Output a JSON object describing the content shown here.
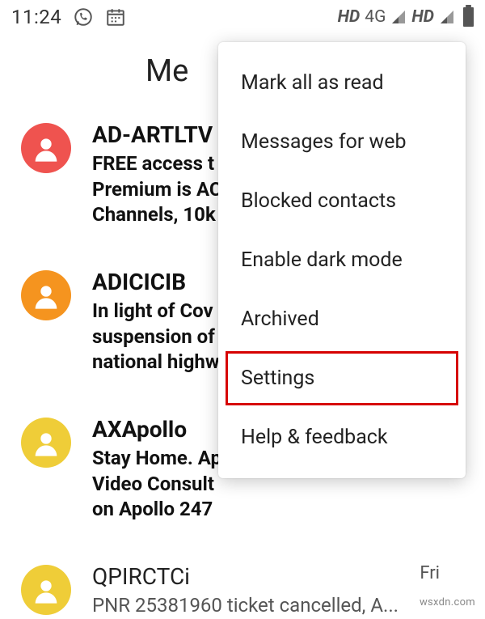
{
  "status": {
    "time": "11:24",
    "net1": "HD",
    "net1b": "4G",
    "net2": "HD"
  },
  "page_title": "Me",
  "conversations": [
    {
      "name": "AD-ARTLTV",
      "snippet": "FREE access t\nPremium is AC\nChannels, 10k",
      "unread": true,
      "avatar_color": "#ef534f"
    },
    {
      "name": "ADICICIB",
      "snippet": "In light of Cov\nsuspension of\nnational highw",
      "unread": true,
      "avatar_color": "#f5941f"
    },
    {
      "name": "AXApollo",
      "snippet": "Stay Home. Ap\nVideo Consult\non Apollo 247",
      "unread": true,
      "avatar_color": "#efcd38"
    },
    {
      "name": "QPIRCTCi",
      "snippet": "PNR 25381960  ticket cancelled, A...",
      "unread": false,
      "avatar_color": "#efcd38",
      "date": "Fri"
    }
  ],
  "menu": {
    "items": [
      "Mark all as read",
      "Messages for web",
      "Blocked contacts",
      "Enable dark mode",
      "Archived",
      "Settings",
      "Help & feedback"
    ],
    "highlight_index": 5
  },
  "watermark": "wsxdn.com"
}
